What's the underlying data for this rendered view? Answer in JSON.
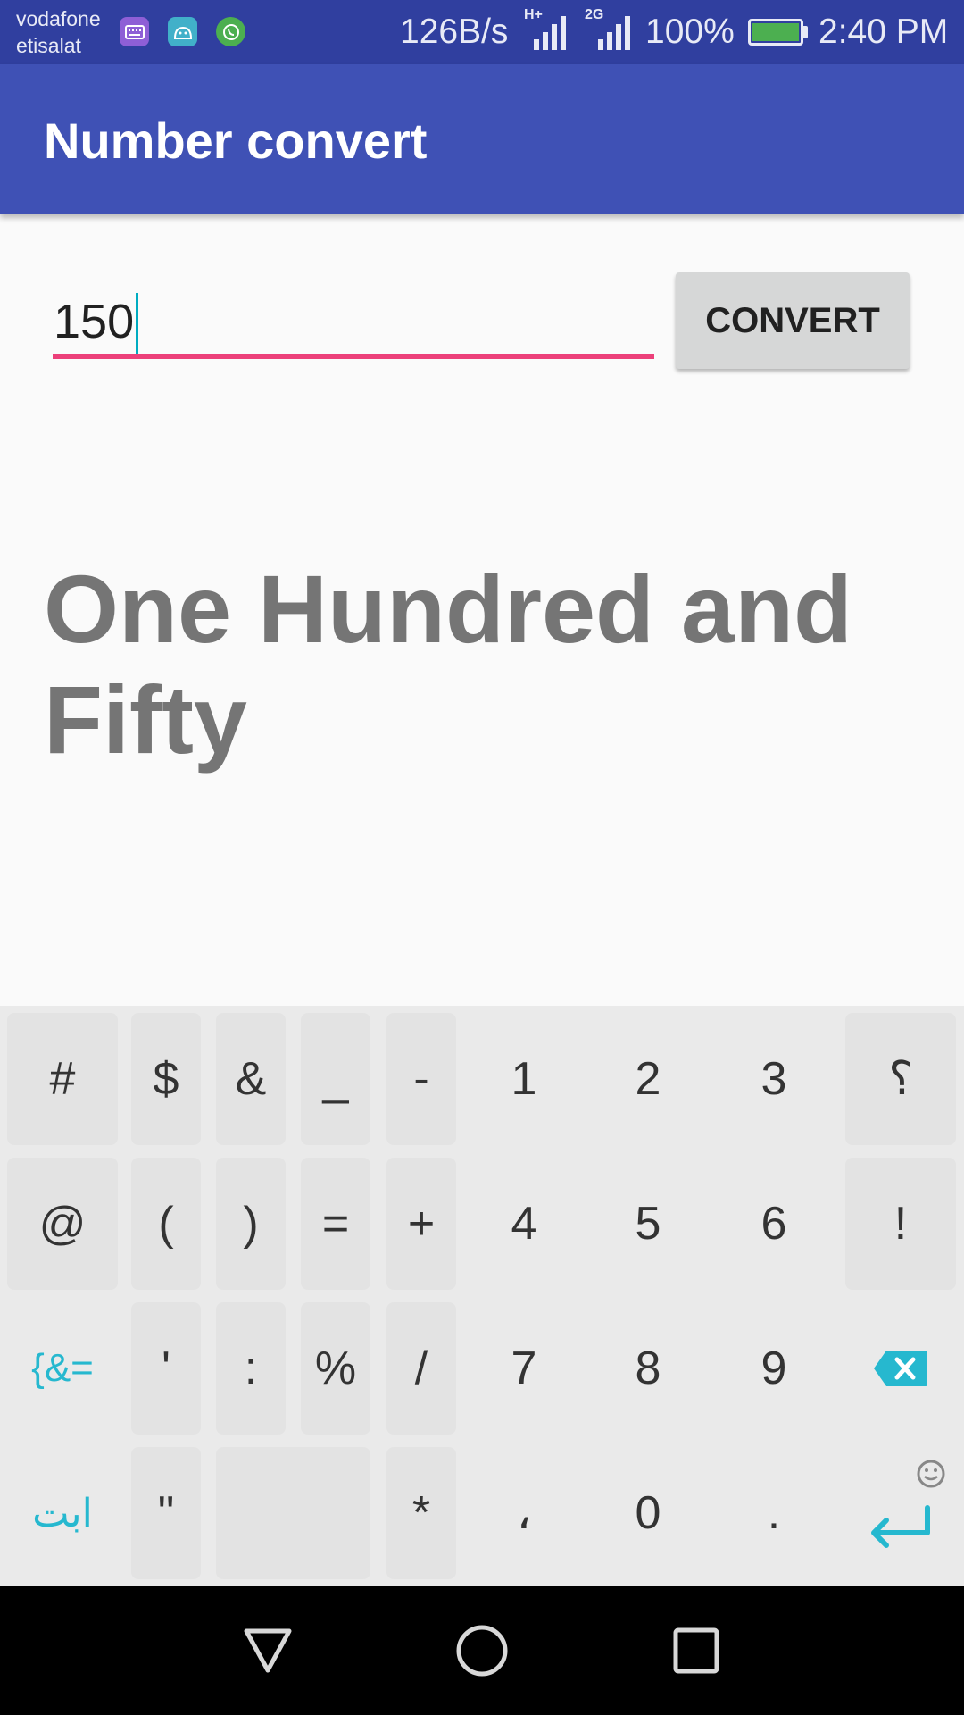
{
  "status_bar": {
    "carrier_1": "vodafone",
    "carrier_2": "etisalat",
    "notification_icons": [
      "keyboard-icon",
      "android-icon",
      "whatsapp-icon"
    ],
    "speed": "126B/s",
    "network_1": "H+",
    "network_2": "2G",
    "battery": "100%",
    "time": "2:40 PM"
  },
  "app_bar": {
    "title": "Number convert"
  },
  "form": {
    "input_value": "150",
    "button_label": "CONVERT"
  },
  "result": {
    "text": "One Hundred and Fifty"
  },
  "keyboard": {
    "rows": [
      [
        {
          "label": "#"
        },
        {
          "label": "$"
        },
        {
          "label": "&"
        },
        {
          "label": "_"
        },
        {
          "label": "-"
        },
        {
          "label": "1"
        },
        {
          "label": "2"
        },
        {
          "label": "3"
        },
        {
          "label": "؟"
        }
      ],
      [
        {
          "label": "@"
        },
        {
          "label": "("
        },
        {
          "label": ")"
        },
        {
          "label": "="
        },
        {
          "label": "+"
        },
        {
          "label": "4"
        },
        {
          "label": "5"
        },
        {
          "label": "6"
        },
        {
          "label": "!"
        }
      ],
      [
        {
          "label": "{&="
        },
        {
          "label": "'"
        },
        {
          "label": ":"
        },
        {
          "label": "%"
        },
        {
          "label": "/"
        },
        {
          "label": "7"
        },
        {
          "label": "8"
        },
        {
          "label": "9"
        },
        {
          "icon": "backspace-icon"
        }
      ],
      [
        {
          "label": "ابت"
        },
        {
          "label": "\""
        },
        {
          "icon": "space-bar"
        },
        {
          "label": "*"
        },
        {
          "label": "،"
        },
        {
          "label": "0"
        },
        {
          "label": "."
        },
        {
          "icon": "enter-icon"
        }
      ]
    ],
    "accent_color": "#26b8cf"
  },
  "nav_bar": {
    "buttons": [
      "back-icon",
      "home-icon",
      "recents-icon"
    ]
  },
  "colors": {
    "status_bar": "#303f9f",
    "app_bar": "#3f51b5",
    "input_underline": "#ec407a",
    "result_text": "#757575"
  }
}
